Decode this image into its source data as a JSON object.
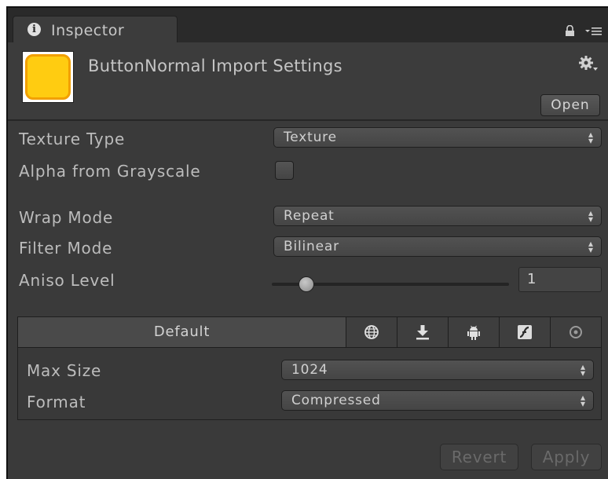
{
  "tab": {
    "title": "Inspector",
    "info_icon": "i"
  },
  "asset": {
    "title": "ButtonNormal Import Settings",
    "thumb_color": "#ffcc11",
    "open_label": "Open"
  },
  "fields": {
    "texture_type": {
      "label": "Texture Type",
      "value": "Texture"
    },
    "alpha_from_grayscale": {
      "label": "Alpha from Grayscale",
      "checked": false
    },
    "wrap_mode": {
      "label": "Wrap Mode",
      "value": "Repeat"
    },
    "filter_mode": {
      "label": "Filter Mode",
      "value": "Bilinear"
    },
    "aniso_level": {
      "label": "Aniso Level",
      "value": "1"
    }
  },
  "platforms": {
    "default_label": "Default",
    "icons": [
      "globe-icon",
      "download-icon",
      "android-icon",
      "flash-icon",
      "blackberry-icon"
    ]
  },
  "platform_fields": {
    "max_size": {
      "label": "Max Size",
      "value": "1024"
    },
    "format": {
      "label": "Format",
      "value": "Compressed"
    }
  },
  "buttons": {
    "revert": "Revert",
    "apply": "Apply"
  },
  "colors": {
    "panel": "#3a3a3a",
    "accent_yellow": "#ffcc11"
  }
}
